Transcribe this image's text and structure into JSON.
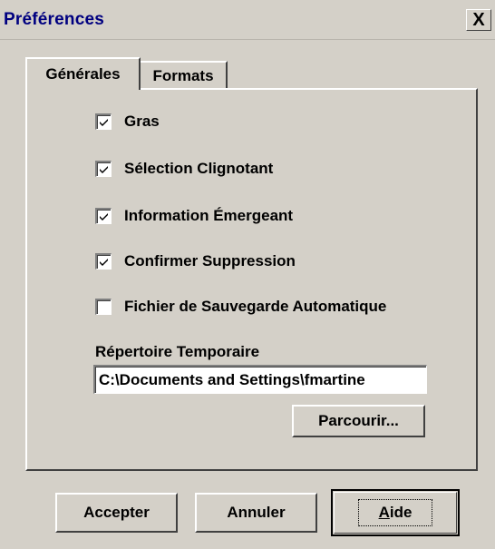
{
  "window": {
    "title": "Préférences",
    "close_symbol": "X"
  },
  "tabs": [
    {
      "label": "Générales",
      "active": true
    },
    {
      "label": "Formats",
      "active": false
    }
  ],
  "options": [
    {
      "label": "Gras",
      "checked": true
    },
    {
      "label": "Sélection Clignotant",
      "checked": true
    },
    {
      "label": "Information Émergeant",
      "checked": true
    },
    {
      "label": "Confirmer Suppression",
      "checked": true
    },
    {
      "label": "Fichier de Sauvegarde Automatique",
      "checked": false
    }
  ],
  "temp_dir": {
    "label": "Répertoire Temporaire",
    "value": "C:\\Documents and Settings\\fmartine",
    "browse_label": "Parcourir..."
  },
  "buttons": {
    "accept": "Accepter",
    "cancel": "Annuler",
    "help_underlined": "A",
    "help_rest": "ide"
  },
  "colors": {
    "face": "#d4d0c8",
    "title_text": "#000080"
  },
  "icons": {
    "close": "close-icon",
    "check": "checkmark-icon"
  }
}
